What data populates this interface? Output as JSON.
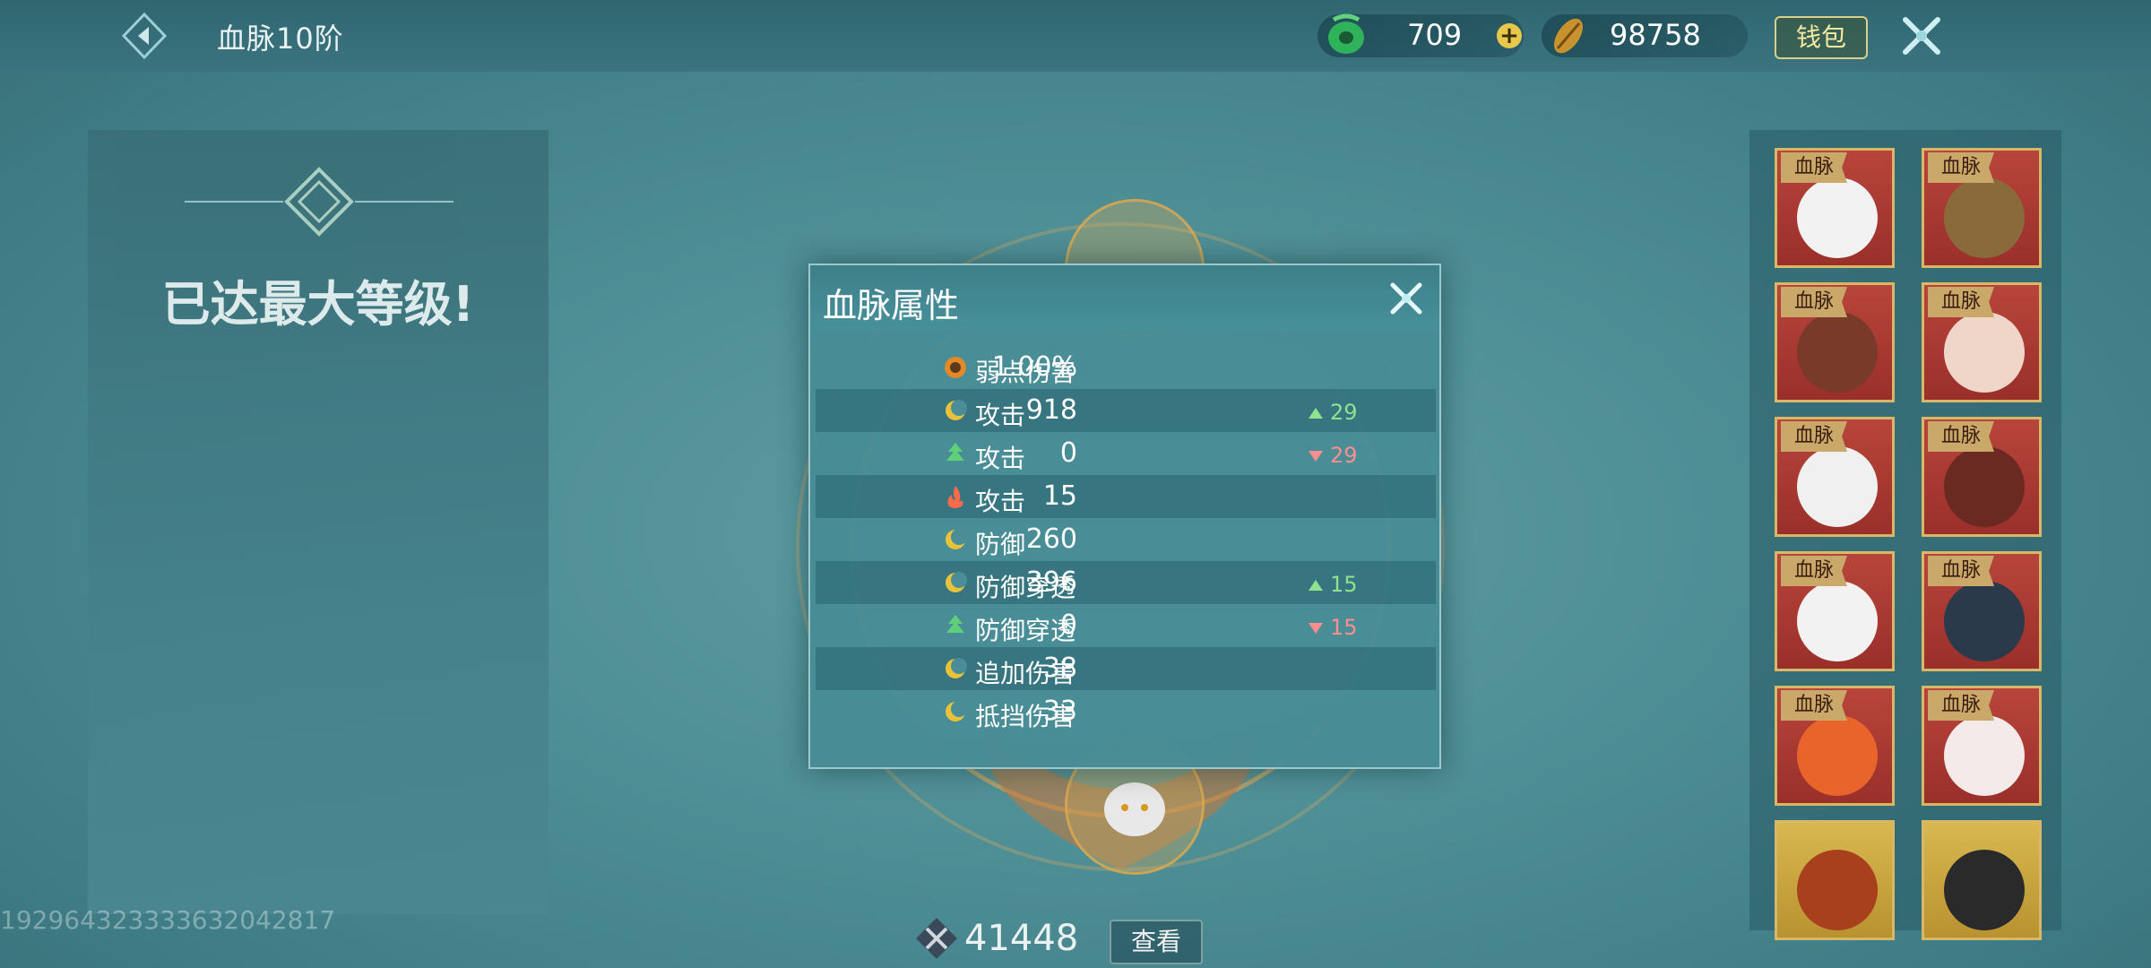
{
  "header": {
    "title": "血脉10阶",
    "currency_jade": "709",
    "currency_gold": "98758",
    "wallet_label": "钱包"
  },
  "left": {
    "status": "已达最大等级!",
    "uid": "192964323333632042817"
  },
  "bottom": {
    "power": "41448",
    "view_label": "查看"
  },
  "popup": {
    "title": "血脉属性",
    "rows": [
      {
        "icon": "weakpoint-icon",
        "label": "弱点伤害",
        "value": "1.00%",
        "delta": "",
        "dir": ""
      },
      {
        "icon": "moon-icon",
        "label": "攻击",
        "value": "918",
        "delta": "29",
        "dir": "up"
      },
      {
        "icon": "tree-icon",
        "label": "攻击",
        "value": "0",
        "delta": "29",
        "dir": "down"
      },
      {
        "icon": "fire-icon",
        "label": "攻击",
        "value": "15",
        "delta": "",
        "dir": ""
      },
      {
        "icon": "moon-icon",
        "label": "防御",
        "value": "260",
        "delta": "",
        "dir": ""
      },
      {
        "icon": "moon-icon",
        "label": "防御穿透",
        "value": "396",
        "delta": "15",
        "dir": "up"
      },
      {
        "icon": "tree-icon",
        "label": "防御穿透",
        "value": "0",
        "delta": "15",
        "dir": "down"
      },
      {
        "icon": "moon-icon",
        "label": "追加伤害",
        "value": "38",
        "delta": "",
        "dir": ""
      },
      {
        "icon": "moon-icon",
        "label": "抵挡伤害",
        "value": "33",
        "delta": "",
        "dir": ""
      }
    ]
  },
  "bloodline_tag": "血脉",
  "cards": [
    {
      "name": "panda",
      "tagged": true
    },
    {
      "name": "wolf-dragon",
      "tagged": true
    },
    {
      "name": "dragon-red",
      "tagged": true
    },
    {
      "name": "lion",
      "tagged": true
    },
    {
      "name": "white-cat",
      "tagged": true
    },
    {
      "name": "red-beast",
      "tagged": true
    },
    {
      "name": "white-wolf",
      "tagged": true
    },
    {
      "name": "blue-dragon",
      "tagged": true
    },
    {
      "name": "phoenix",
      "tagged": true
    },
    {
      "name": "white-rabbit",
      "tagged": true
    },
    {
      "name": "red-panda",
      "tagged": false
    },
    {
      "name": "black-dragon",
      "tagged": false
    }
  ],
  "colors": {
    "accent_gold": "#d8b866",
    "card_red": "#b8453b",
    "up": "#8fe28f",
    "down": "#ff8e8e"
  }
}
